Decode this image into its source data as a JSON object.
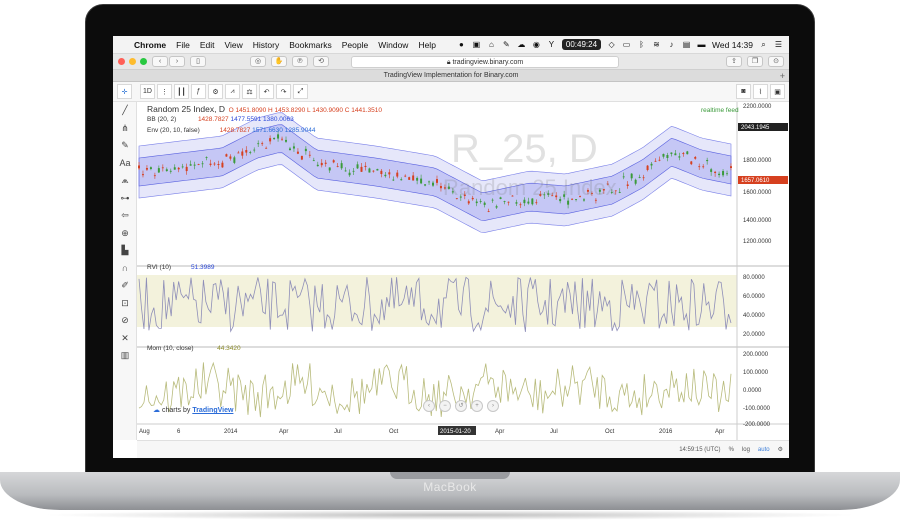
{
  "device": {
    "brand": "MacBook"
  },
  "menubar": {
    "app": "Chrome",
    "items": [
      "File",
      "Edit",
      "View",
      "History",
      "Bookmarks",
      "People",
      "Window",
      "Help"
    ],
    "timer": "00:49:24",
    "clock": "Wed 14:39"
  },
  "browser": {
    "url": "tradingview.binary.com",
    "tab_title": "TradingView Implementation for Binary.com"
  },
  "tv": {
    "interval": "1D",
    "symbol_title": "Random 25 Index, D",
    "ohlc": {
      "o": "O 1451.8090",
      "h": "H 1453.8290",
      "l": "L 1430.9090",
      "c": "C 1441.3510"
    },
    "bb": {
      "name": "BB (20, 2)",
      "v1": "1428.7827",
      "v2": "1477.5591",
      "v3": "1380.0063"
    },
    "env": {
      "name": "Env (20, 10, false)",
      "v1": "1428.7827",
      "v2": "1571.6630",
      "v3": "1285.9044"
    },
    "realtime": "realtime feed",
    "watermark_big": "R_25, D",
    "watermark_small": "Random 25 Index",
    "rvi": {
      "name": "RVI (10)",
      "value": "51.3989"
    },
    "mom": {
      "name": "Mom (10, close)",
      "value": "44.3420"
    },
    "charts_by": "charts by",
    "charts_by_brand": "TradingView",
    "price_axis_main": [
      "2200.0000",
      "2043.1945",
      "1800.0000",
      "1657.0610",
      "1600.0000",
      "1400.0000",
      "1200.0000"
    ],
    "price_axis_rvi": [
      "80.0000",
      "60.0000",
      "40.0000",
      "20.0000"
    ],
    "price_axis_mom": [
      "200.0000",
      "100.0000",
      "0.0000",
      "-100.0000",
      "-200.0000"
    ],
    "time_axis": [
      "Aug",
      "6",
      "2014",
      "Apr",
      "Jul",
      "Oct",
      "2015-01-20",
      "Apr",
      "Jul",
      "Oct",
      "2016",
      "Apr"
    ],
    "bottom_bar": {
      "time": "14:59:15 (UTC)",
      "pct": "%",
      "log": "log",
      "auto": "auto"
    },
    "colors": {
      "candle_up": "#3a9a3a",
      "candle_down": "#d6401f",
      "band_fill": "#c7c9f5",
      "rvi_line": "#8e8eb8",
      "mom_line": "#b8bb7c",
      "rvi_bg": "#f3f2dc"
    }
  }
}
